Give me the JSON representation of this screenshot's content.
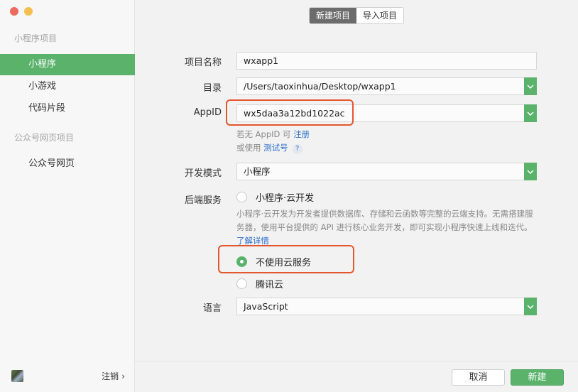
{
  "sidebar": {
    "section_miniprogram": "小程序项目",
    "items_miniprogram": [
      "小程序",
      "小游戏",
      "代码片段"
    ],
    "section_official": "公众号网页项目",
    "items_official": [
      "公众号网页"
    ],
    "logout_label": "注销",
    "logout_chevron": "›"
  },
  "tabs": [
    "新建项目",
    "导入项目"
  ],
  "form": {
    "project_name_label": "项目名称",
    "project_name_value": "wxapp1",
    "directory_label": "目录",
    "directory_value": "/Users/taoxinhua/Desktop/wxapp1",
    "appid_label": "AppID",
    "appid_value": "wx5daa3a12bd1022ac",
    "appid_hint_prefix": "若无 AppID 可 ",
    "appid_hint_register": "注册",
    "appid_hint2_prefix": "或使用 ",
    "appid_hint2_test": "测试号",
    "appid_help": "?",
    "dev_mode_label": "开发模式",
    "dev_mode_value": "小程序",
    "backend_label": "后端服务",
    "backend_options": [
      "小程序·云开发",
      "不使用云服务",
      "腾讯云"
    ],
    "backend_selected": "不使用云服务",
    "cloud_desc": "小程序·云开发为开发者提供数据库、存储和云函数等完整的云端支持。无需搭建服务器，使用平台提供的 API 进行核心业务开发，即可实现小程序快速上线和迭代。",
    "cloud_desc_link": "了解详情",
    "language_label": "语言",
    "language_value": "JavaScript"
  },
  "buttons": {
    "cancel": "取消",
    "create": "新建"
  },
  "colors": {
    "accent": "#5ab26b",
    "highlight": "#e3572f",
    "link": "#2c6ec9"
  }
}
